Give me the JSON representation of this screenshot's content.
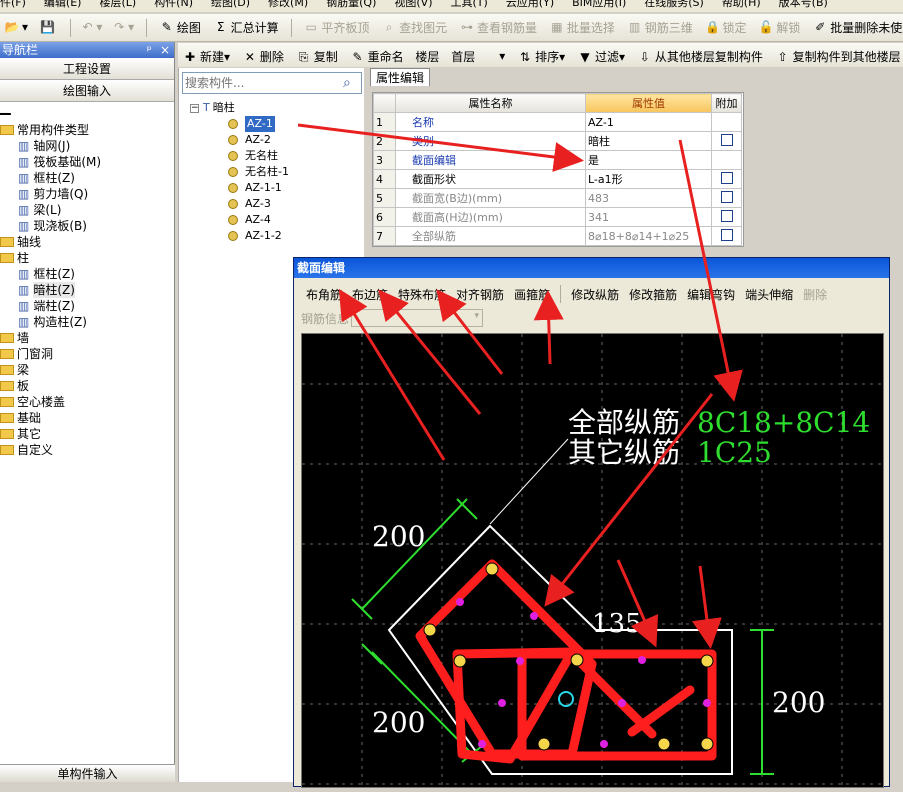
{
  "menu": [
    "件(F)",
    "编辑(E)",
    "楼层(L)",
    "构件(N)",
    "绘图(D)",
    "修改(M)",
    "钢筋量(Q)",
    "视图(V)",
    "工具(T)",
    "云应用(Y)",
    "BIM应用(I)",
    "在线服务(S)",
    "帮助(H)",
    "版本号(B)"
  ],
  "toolbar1": {
    "draw": "绘图",
    "sum": "汇总计算",
    "flat_top": "平齐板顶",
    "find": "查找图元",
    "view_rebar": "查看钢筋量",
    "batch_select": "批量选择",
    "rebar3d": "钢筋三维",
    "lock": "锁定",
    "unlock": "解锁",
    "batch_delete": "批量删除未使用构件"
  },
  "toolbar2": {
    "new": "新建",
    "delete": "删除",
    "copy": "复制",
    "rename": "重命名",
    "floor_label": "楼层",
    "floor_value": "首层",
    "sort": "排序",
    "filter": "过滤",
    "copy_from": "从其他楼层复制构件",
    "copy_to": "复制构件到其他楼层"
  },
  "nav": {
    "title": "导航栏",
    "pin": "ᵖ",
    "close": "×",
    "btn1": "工程设置",
    "btn2": "绘图输入",
    "bottom": "单构件输入",
    "items": [
      {
        "label": "常用构件类型",
        "indent": 0,
        "type": "folder"
      },
      {
        "label": "轴网(J)",
        "indent": 1,
        "type": "leaf"
      },
      {
        "label": "筏板基础(M)",
        "indent": 1,
        "type": "leaf"
      },
      {
        "label": "框柱(Z)",
        "indent": 1,
        "type": "leaf"
      },
      {
        "label": "剪力墙(Q)",
        "indent": 1,
        "type": "leaf"
      },
      {
        "label": "梁(L)",
        "indent": 1,
        "type": "leaf"
      },
      {
        "label": "现浇板(B)",
        "indent": 1,
        "type": "leaf"
      },
      {
        "label": "轴线",
        "indent": 0,
        "type": "folder"
      },
      {
        "label": "柱",
        "indent": 0,
        "type": "folder"
      },
      {
        "label": "框柱(Z)",
        "indent": 1,
        "type": "leaf"
      },
      {
        "label": "暗柱(Z)",
        "indent": 1,
        "type": "leaf"
      },
      {
        "label": "端柱(Z)",
        "indent": 1,
        "type": "leaf"
      },
      {
        "label": "构造柱(Z)",
        "indent": 1,
        "type": "leaf"
      },
      {
        "label": "墙",
        "indent": 0,
        "type": "folder"
      },
      {
        "label": "门窗洞",
        "indent": 0,
        "type": "folder"
      },
      {
        "label": "梁",
        "indent": 0,
        "type": "folder"
      },
      {
        "label": "板",
        "indent": 0,
        "type": "folder"
      },
      {
        "label": "空心楼盖",
        "indent": 0,
        "type": "folder"
      },
      {
        "label": "基础",
        "indent": 0,
        "type": "folder"
      },
      {
        "label": "其它",
        "indent": 0,
        "type": "folder"
      },
      {
        "label": "自定义",
        "indent": 0,
        "type": "folder"
      }
    ]
  },
  "search": {
    "placeholder": "搜索构件..."
  },
  "tree": {
    "root": "暗柱",
    "items": [
      "AZ-1",
      "AZ-2",
      "无名柱",
      "无名柱-1",
      "AZ-1-1",
      "AZ-3",
      "AZ-4",
      "AZ-1-2"
    ]
  },
  "props": {
    "tab": "属性编辑",
    "headers": [
      "属性名称",
      "属性值",
      "附加"
    ],
    "rows": [
      {
        "n": "1",
        "name": "名称",
        "value": "AZ-1",
        "chk": false,
        "style": "blue"
      },
      {
        "n": "2",
        "name": "类别",
        "value": "暗柱",
        "chk": true,
        "style": "blue"
      },
      {
        "n": "3",
        "name": "截面编辑",
        "value": "是",
        "chk": false,
        "style": "blue"
      },
      {
        "n": "4",
        "name": "截面形状",
        "value": "L-a1形",
        "chk": true,
        "style": ""
      },
      {
        "n": "5",
        "name": "截面宽(B边)(mm)",
        "value": "483",
        "chk": true,
        "style": "gray"
      },
      {
        "n": "6",
        "name": "截面高(H边)(mm)",
        "value": "341",
        "chk": true,
        "style": "gray"
      },
      {
        "n": "7",
        "name": "全部纵筋",
        "value": "8⌀18+8⌀14+1⌀25",
        "chk": true,
        "style": "gray"
      }
    ]
  },
  "dialog": {
    "title": "截面编辑",
    "tools": [
      "布角筋",
      "布边筋",
      "特殊布筋",
      "对齐钢筋",
      "画箍筋",
      "修改纵筋",
      "修改箍筋",
      "编辑弯钩",
      "端头伸缩",
      "删除"
    ],
    "rebar_info": "钢筋信息",
    "all_rebar_label": "全部纵筋",
    "all_rebar_value": "8C18+8C14",
    "other_rebar_label": "其它纵筋",
    "other_rebar_value": "1C25",
    "dim_200_top": "200",
    "dim_200_left": "200",
    "dim_135": "135",
    "dim_200_right": "200"
  },
  "colors": {
    "highlight": "#316ac5",
    "rebar": "#ff1e1e",
    "dim": "#2ede2e",
    "arrow": "#e82020"
  }
}
